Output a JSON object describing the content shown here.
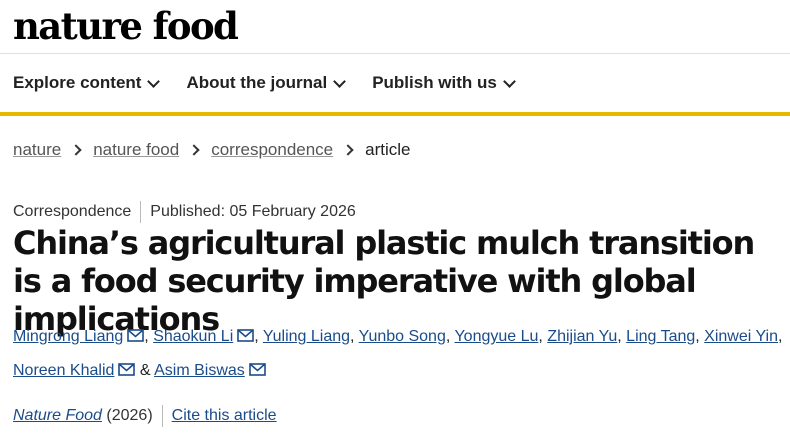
{
  "brand": {
    "logo_text": "nature food"
  },
  "nav": {
    "items": [
      {
        "label": "Explore content"
      },
      {
        "label": "About the journal"
      },
      {
        "label": "Publish with us"
      }
    ]
  },
  "breadcrumb": {
    "items": [
      "nature",
      "nature food",
      "correspondence"
    ],
    "current": "article"
  },
  "article": {
    "type": "Correspondence",
    "published": "Published: 05 February 2026",
    "title": "China’s agricultural plastic mulch transition is a food security imperative with global implications",
    "authors": [
      {
        "name": "Mingrong Liang",
        "separator": ", "
      },
      {
        "name": "Shaokun Li",
        "separator": ", "
      },
      {
        "name": "Yuling Liang",
        "separator": ", "
      },
      {
        "name": "Yunbo Song",
        "separator": ", "
      },
      {
        "name": "Yongyue Lu",
        "separator": ", "
      },
      {
        "name": "Zhijian Yu",
        "separator": ", "
      },
      {
        "name": "Ling Tang",
        "separator": ", "
      },
      {
        "name": "Xinwei Yin",
        "separator": ", "
      },
      {
        "name": "Noreen Khalid",
        "separator": " & "
      },
      {
        "name": "Asim Biswas",
        "separator": ""
      }
    ],
    "journal": "Nature Food",
    "year": "(2026)",
    "cite_label": "Cite this article"
  },
  "icons": {
    "email": "mail-icon",
    "dropdown": "chevron-down-icon",
    "breadcrumb_separator": "chevron-right-icon"
  },
  "colors": {
    "accent_bar": "#e6b800",
    "link": "#1a4c8a"
  }
}
